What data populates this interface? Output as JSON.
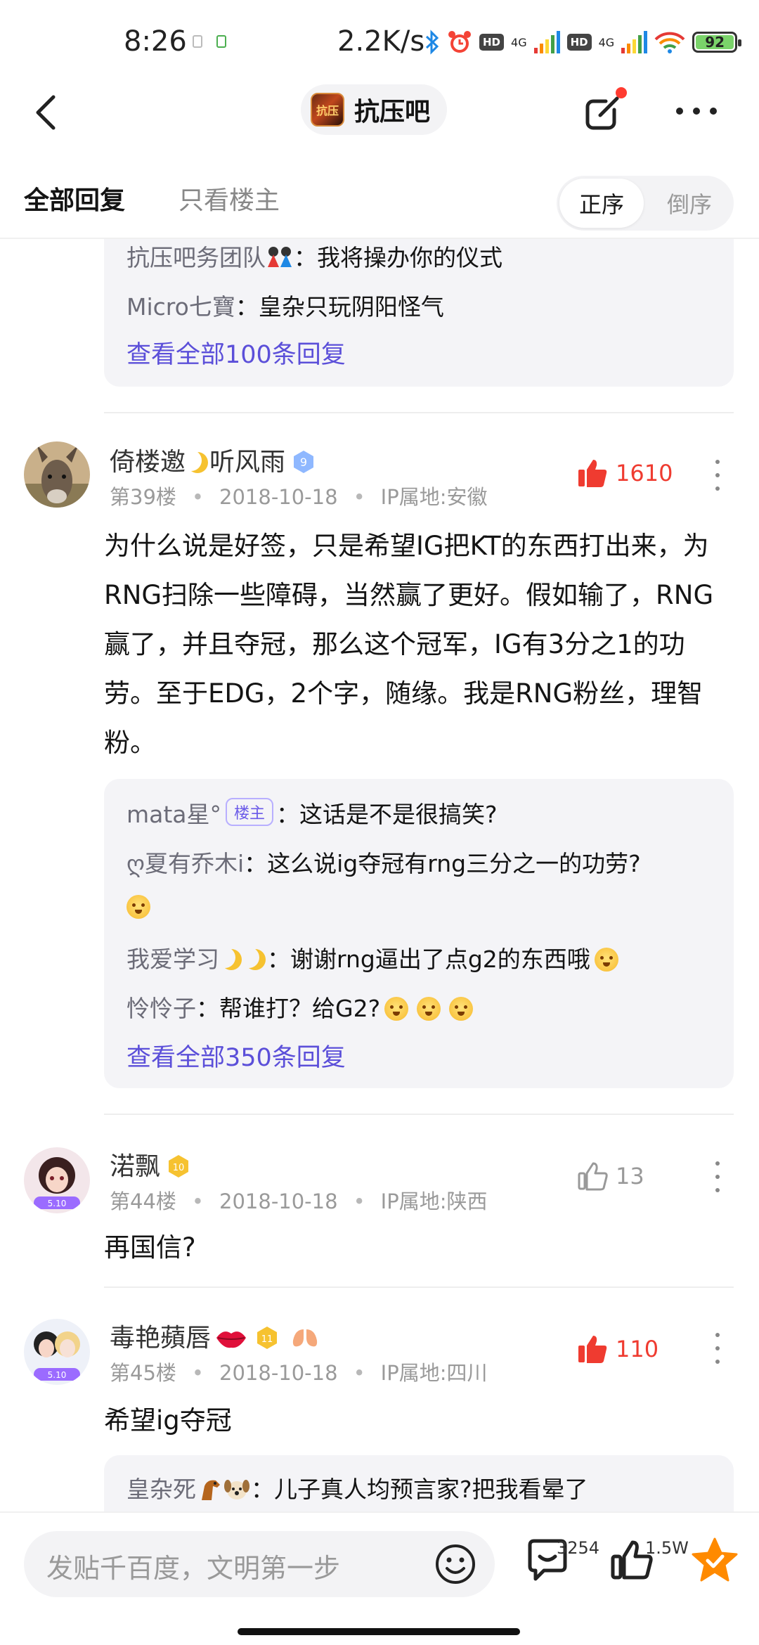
{
  "status_bar": {
    "time": "8:26",
    "speed": "2.2K/s",
    "hd": "HD",
    "network": "4G",
    "battery": "92"
  },
  "nav": {
    "forum_name": "抗压吧",
    "forum_avatar_text": "抗压"
  },
  "tabs": {
    "all_replies": "全部回复",
    "op_only": "只看楼主",
    "sort_asc": "正序",
    "sort_desc": "倒序"
  },
  "prev_replies": {
    "r1_name": "抗压吧务团队",
    "r1_text": "：我将操办你的仪式",
    "r2_name": "Micro七寶",
    "r2_text": "：皇杂只玩阴阳怪气",
    "view_all": "查看全部100条回复"
  },
  "posts": [
    {
      "name": "倚楼邀",
      "name_suffix": "听风雨",
      "level": "9",
      "floor": "第39楼",
      "date": "2018-10-18",
      "ip": "IP属地:安徽",
      "likes": "1610",
      "liked": true,
      "body": "为什么说是好签，只是希望IG把KT的东西打出来，为RNG扫除一些障碍，当然赢了更好。假如输了，RNG赢了，并且夺冠，那么这个冠军，IG有3分之1的功劳。至于EDG，2个字，随缘。我是RNG粉丝，理智粉。",
      "replies": {
        "r1_name": "mata星°",
        "r1_tag": "楼主",
        "r1_text": "：这话是不是很搞笑?",
        "r2_name": "ღ夏有乔木i",
        "r2_text": "：这么说ig夺冠有rng三分之一的功劳?",
        "r3_name": "我爱学习",
        "r3_text": "：谢谢rng逼出了点g2的东西哦",
        "r4_name": "怜怜子",
        "r4_text": "：帮谁打？给G2?",
        "view_all": "查看全部350条回复"
      }
    },
    {
      "name": "渃飘",
      "level": "10",
      "floor": "第44楼",
      "date": "2018-10-18",
      "ip": "IP属地:陕西",
      "likes": "13",
      "liked": false,
      "body": "再国信?",
      "avatar_badge": "5.10"
    },
    {
      "name": "毒艳蘋唇",
      "level": "11",
      "floor": "第45楼",
      "date": "2018-10-18",
      "ip": "IP属地:四川",
      "likes": "110",
      "liked": true,
      "body": "希望ig夺冠",
      "avatar_badge": "5.10",
      "replies": {
        "r1_name": "皇杂死",
        "r1_text": "：儿子真人均预言家?把我看晕了"
      }
    }
  ],
  "bottom": {
    "placeholder": "发贴千百度，文明第一步",
    "comments_count": "3254",
    "likes_count": "1.5W"
  },
  "colors": {
    "accent_link": "#5b4fd9",
    "like_red": "#ef3b30",
    "star": "#ff8a00"
  }
}
